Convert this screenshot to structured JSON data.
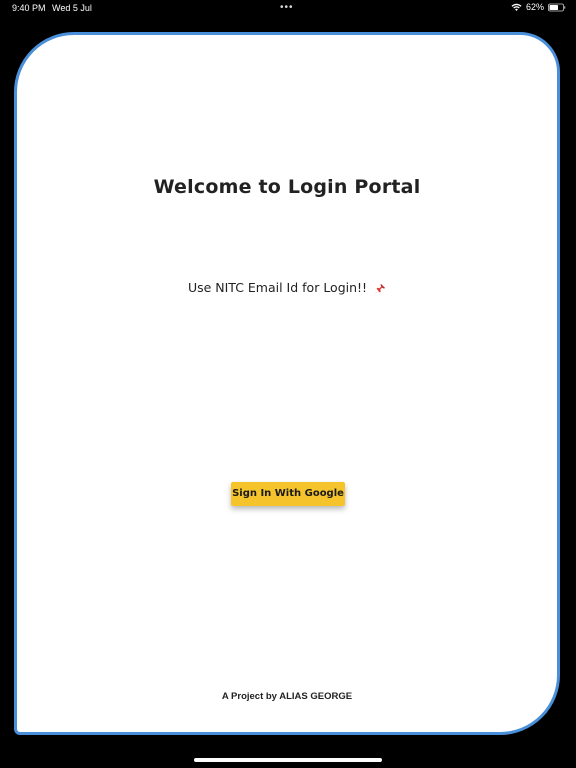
{
  "status_bar": {
    "time": "9:40 PM",
    "date": "Wed 5 Jul",
    "dots": "•••",
    "battery": "62%",
    "icons": [
      "wifi-icon",
      "battery-icon"
    ]
  },
  "login": {
    "title": "Welcome to Login Portal",
    "hint": "Use NITC Email Id for Login!!",
    "hint_icon": "pin-icon",
    "button_label": "Sign In With Google",
    "footer": "A Project by ALIAS GEORGE"
  },
  "colors": {
    "card_border": "#4a8fd9",
    "button_background": "#f5c42c",
    "background": "#000000"
  }
}
